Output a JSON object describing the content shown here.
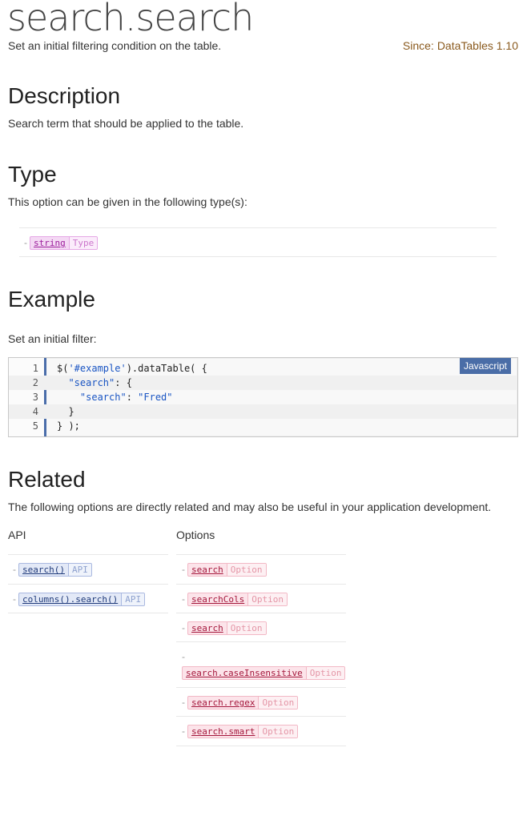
{
  "header": {
    "title": "search.search",
    "subtitle": "Set an initial filtering condition on the table.",
    "since_label": "Since:",
    "since_value": "DataTables 1.10"
  },
  "description": {
    "heading": "Description",
    "text": "Search term that should be applied to the table."
  },
  "type": {
    "heading": "Type",
    "text": "This option can be given in the following type(s):",
    "items": [
      {
        "name": "string",
        "kind": "Type"
      }
    ]
  },
  "example": {
    "heading": "Example",
    "text": "Set an initial filter:",
    "language": "Javascript",
    "lines": [
      {
        "num": "1",
        "pre": "$(",
        "str": "'#example'",
        "post": ").dataTable( {"
      },
      {
        "num": "2",
        "pre": "  ",
        "str": "\"search\"",
        "post": ": {"
      },
      {
        "num": "3",
        "pre": "    ",
        "str": "\"search\"",
        "post": ": ",
        "str2": "\"Fred\""
      },
      {
        "num": "4",
        "pre": "  }",
        "str": "",
        "post": ""
      },
      {
        "num": "5",
        "pre": "} );",
        "str": "",
        "post": ""
      }
    ]
  },
  "related": {
    "heading": "Related",
    "text": "The following options are directly related and may also be useful in your application development.",
    "api_header": "API",
    "options_header": "Options",
    "api": [
      {
        "name": "search()",
        "kind": "API"
      },
      {
        "name": "columns().search()",
        "kind": "API"
      }
    ],
    "options": [
      {
        "name": "search",
        "kind": "Option"
      },
      {
        "name": "searchCols",
        "kind": "Option"
      },
      {
        "name": "search",
        "kind": "Option"
      },
      {
        "name": "search.caseInsensitive",
        "kind": "Option"
      },
      {
        "name": "search.regex",
        "kind": "Option"
      },
      {
        "name": "search.smart",
        "kind": "Option"
      }
    ],
    "dash": "-"
  }
}
